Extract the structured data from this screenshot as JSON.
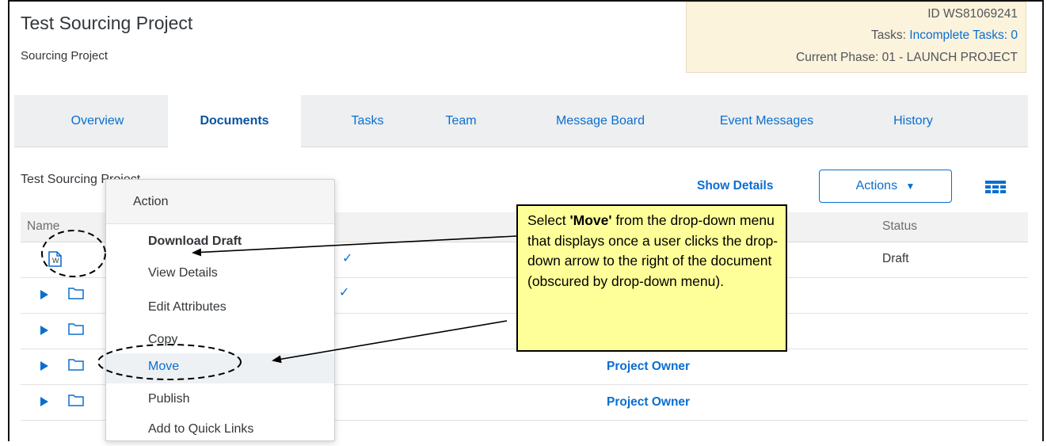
{
  "header": {
    "title": "Test Sourcing Project",
    "subtitle": "Sourcing Project"
  },
  "info": {
    "id_label": "ID WS81069241",
    "tasks_label": "Tasks:",
    "tasks_value": "Incomplete Tasks: 0",
    "phase_label": "Current Phase:",
    "phase_value": "01 - LAUNCH PROJECT"
  },
  "tabs": [
    {
      "label": "Overview"
    },
    {
      "label": "Documents"
    },
    {
      "label": "Tasks"
    },
    {
      "label": "Team"
    },
    {
      "label": "Message Board"
    },
    {
      "label": "Event Messages"
    },
    {
      "label": "History"
    }
  ],
  "active_tab": "Documents",
  "section_title": "Test Sourcing Project",
  "toolbar": {
    "show_details": "Show Details",
    "actions": "Actions",
    "table_icon": "table-settings-icon"
  },
  "table": {
    "columns": [
      "Name",
      "Status"
    ],
    "rows": [
      {
        "icon": "word-document-icon",
        "owner": "",
        "status": "Draft"
      },
      {
        "icon": "folder-icon",
        "owner": "",
        "status": ""
      },
      {
        "icon": "folder-icon",
        "owner": "",
        "status": ""
      },
      {
        "icon": "folder-icon",
        "owner": "Project Owner",
        "status": ""
      },
      {
        "icon": "folder-icon",
        "owner": "Project Owner",
        "status": ""
      }
    ]
  },
  "menu": {
    "header": "Action",
    "items": [
      {
        "label": "Download Draft"
      },
      {
        "label": "View Details"
      },
      {
        "label": "Edit Attributes"
      },
      {
        "label": "Copy"
      },
      {
        "label": "Move"
      },
      {
        "label": "Publish"
      },
      {
        "label": "Add to Quick Links"
      }
    ]
  },
  "callout": {
    "prefix": "Select ",
    "emphasis": "'Move'",
    "text": " from the drop-down menu that displays once a user clicks the drop-down arrow to the right of the document (obscured by drop-down menu)."
  },
  "colors": {
    "accent": "#0a6ed1",
    "info_bg": "#fbf3dc",
    "callout_bg": "#ffff99"
  }
}
